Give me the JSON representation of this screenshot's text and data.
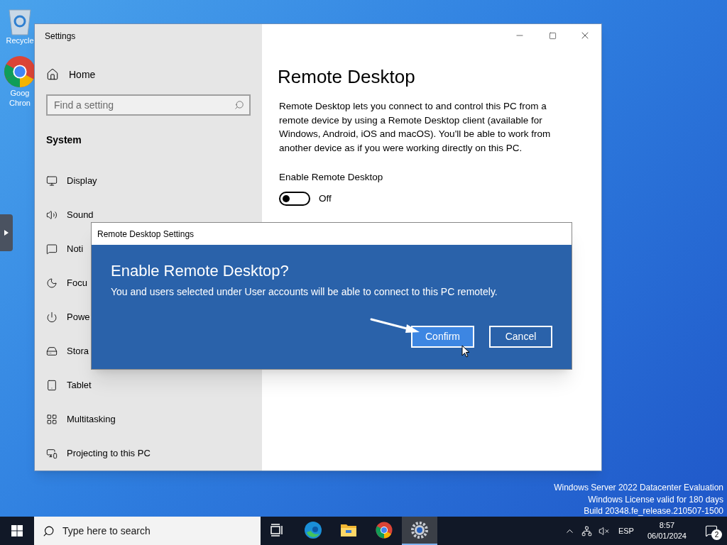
{
  "desktop_icons": [
    {
      "kind": "recycle-bin",
      "lines": [
        "Recycle"
      ]
    },
    {
      "kind": "chrome",
      "lines": [
        "Goog",
        "Chron"
      ]
    }
  ],
  "settings_window": {
    "title": "Settings",
    "home": "Home",
    "search": {
      "placeholder": "Find a setting"
    },
    "section": "System",
    "nav_items": [
      {
        "kind": "display",
        "label": "Display"
      },
      {
        "kind": "sound",
        "label": "Sound"
      },
      {
        "kind": "notifications",
        "label": "Noti"
      },
      {
        "kind": "focus",
        "label": "Focu"
      },
      {
        "kind": "power",
        "label": "Powe"
      },
      {
        "kind": "storage",
        "label": "Stora"
      },
      {
        "kind": "tablet",
        "label": "Tablet"
      },
      {
        "kind": "multitasking",
        "label": "Multitasking"
      },
      {
        "kind": "projecting",
        "label": "Projecting to this PC"
      }
    ],
    "page": {
      "title": "Remote Desktop",
      "description": "Remote Desktop lets you connect to and control this PC from a remote device by using a Remote Desktop client (available for Windows, Android, iOS and macOS). You'll be able to work from another device as if you were working directly on this PC.",
      "toggle": {
        "label": "Enable Remote Desktop",
        "on": false,
        "state_text": "Off"
      }
    }
  },
  "dialog": {
    "title": "Remote Desktop Settings",
    "heading": "Enable Remote Desktop?",
    "message": "You and users selected under User accounts will be able to connect to this PC remotely.",
    "buttons": [
      {
        "label": "Confirm",
        "selected": true
      },
      {
        "label": "Cancel",
        "selected": false
      }
    ]
  },
  "watermark": [
    "Windows Server 2022 Datacenter Evaluation",
    "Windows License valid for 180 days",
    "Build 20348.fe_release.210507-1500"
  ],
  "taskbar": {
    "search": {
      "placeholder": "Type here to search"
    },
    "apps": [
      {
        "kind": "task-view",
        "active": false
      },
      {
        "kind": "edge",
        "active": false
      },
      {
        "kind": "explorer",
        "active": false
      },
      {
        "kind": "chrome",
        "active": false
      },
      {
        "kind": "settings",
        "active": true
      }
    ],
    "language": "ESP",
    "time": "8:57",
    "date": "06/01/2024",
    "notification_count": "2"
  }
}
